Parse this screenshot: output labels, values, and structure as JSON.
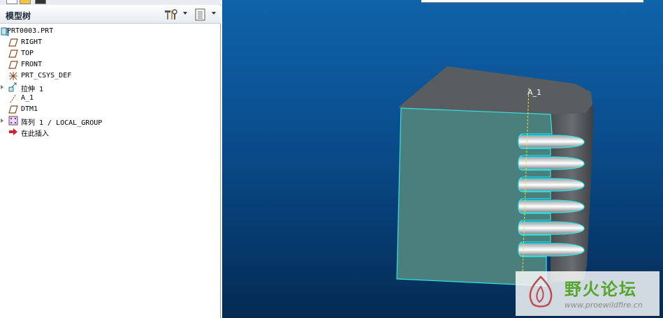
{
  "panel": {
    "title": "模型树",
    "tree": [
      {
        "label": "PRT0003.PRT",
        "icon": "part-icon"
      },
      {
        "label": "RIGHT",
        "icon": "datum-plane-icon"
      },
      {
        "label": "TOP",
        "icon": "datum-plane-icon"
      },
      {
        "label": "FRONT",
        "icon": "datum-plane-icon"
      },
      {
        "label": "PRT_CSYS_DEF",
        "icon": "coordinate-system-icon"
      },
      {
        "label": "拉伸 1",
        "icon": "extrude-icon"
      },
      {
        "label": "A_1",
        "icon": "datum-axis-icon"
      },
      {
        "label": "DTM1",
        "icon": "datum-plane-icon"
      },
      {
        "label": "阵列 1 / LOCAL_GROUP",
        "icon": "pattern-icon"
      },
      {
        "label": "在此插入",
        "icon": "insert-here-arrow-icon"
      }
    ]
  },
  "viewport": {
    "axis_label": "A_1",
    "watermark_text": "野火论坛",
    "watermark_url": "www.proewildfire.cn"
  },
  "colors": {
    "background_top": "#0f63a8",
    "background_bottom": "#042b52",
    "highlight": "#2ee6e6",
    "front_face": "#4a7f7c",
    "model_gray": "#5e6163"
  }
}
